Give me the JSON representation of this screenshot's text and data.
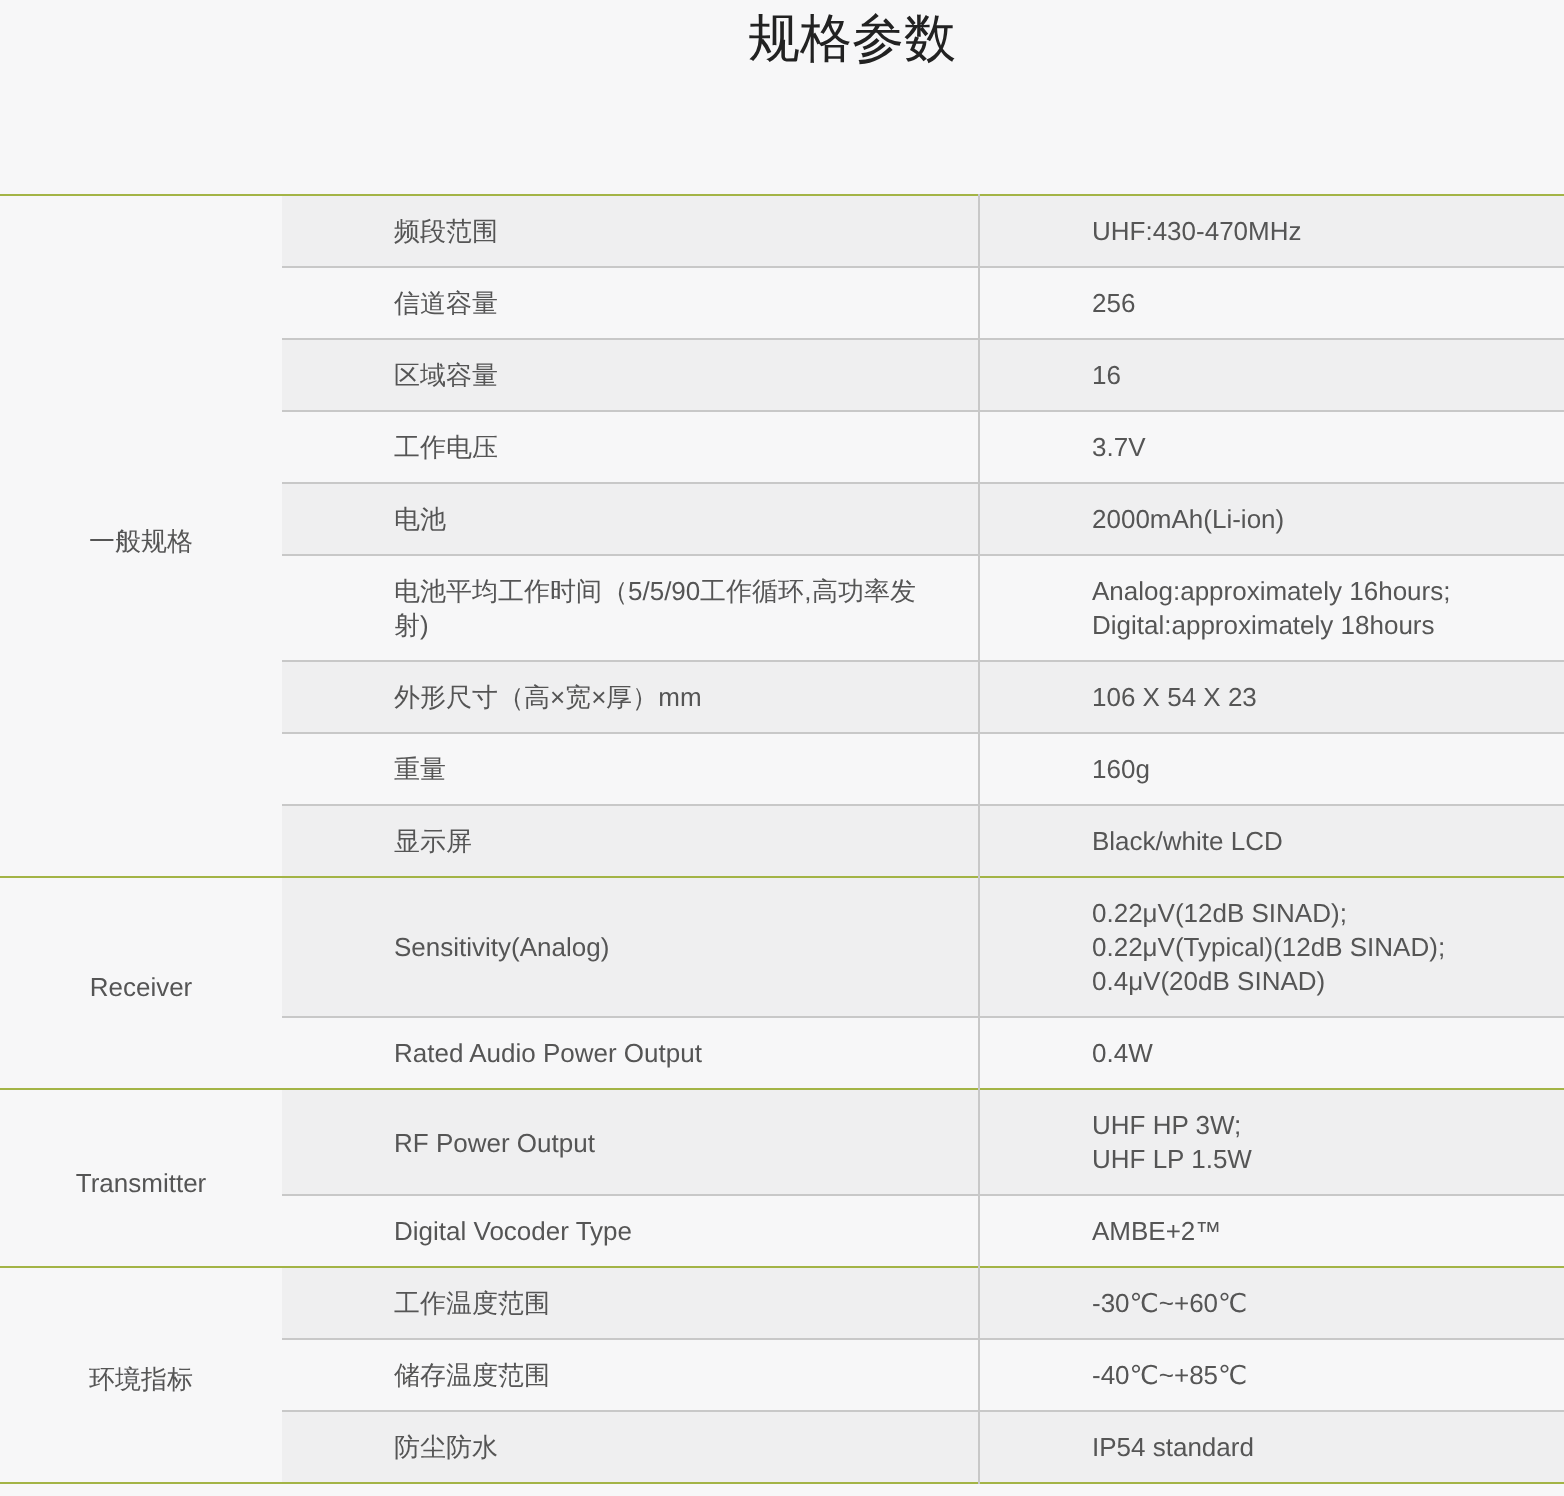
{
  "title": "规格参数",
  "groups": [
    {
      "label": "一般规格",
      "rows": [
        {
          "name": "频段范围",
          "value": "UHF:430-470MHz"
        },
        {
          "name": "信道容量",
          "value": "256"
        },
        {
          "name": "区域容量",
          "value": "16"
        },
        {
          "name": "工作电压",
          "value": "3.7V"
        },
        {
          "name": "电池",
          "value": "2000mAh(Li-ion)"
        },
        {
          "name": "电池平均工作时间（5/5/90工作循环,高功率发射)",
          "value": "Analog:approximately 16hours;\nDigital:approximately 18hours"
        },
        {
          "name": "外形尺寸（高×宽×厚）mm",
          "value": "106 X 54 X 23"
        },
        {
          "name": "重量",
          "value": "160g"
        },
        {
          "name": "显示屏",
          "value": "Black/white LCD"
        }
      ]
    },
    {
      "label": "Receiver",
      "rows": [
        {
          "name": "Sensitivity(Analog)",
          "value": "0.22μV(12dB SINAD);\n0.22μV(Typical)(12dB SINAD);\n0.4μV(20dB SINAD)"
        },
        {
          "name": "Rated Audio Power Output",
          "value": "0.4W"
        }
      ]
    },
    {
      "label": "Transmitter",
      "rows": [
        {
          "name": "RF Power Output",
          "value": "UHF HP 3W;\nUHF LP 1.5W"
        },
        {
          "name": "Digital Vocoder Type",
          "value": "AMBE+2™"
        }
      ]
    },
    {
      "label": "环境指标",
      "rows": [
        {
          "name": "工作温度范围",
          "value": "-30℃~+60℃"
        },
        {
          "name": "储存温度范围",
          "value": "-40℃~+85℃"
        },
        {
          "name": "防尘防水",
          "value": "IP54 standard"
        }
      ]
    }
  ]
}
